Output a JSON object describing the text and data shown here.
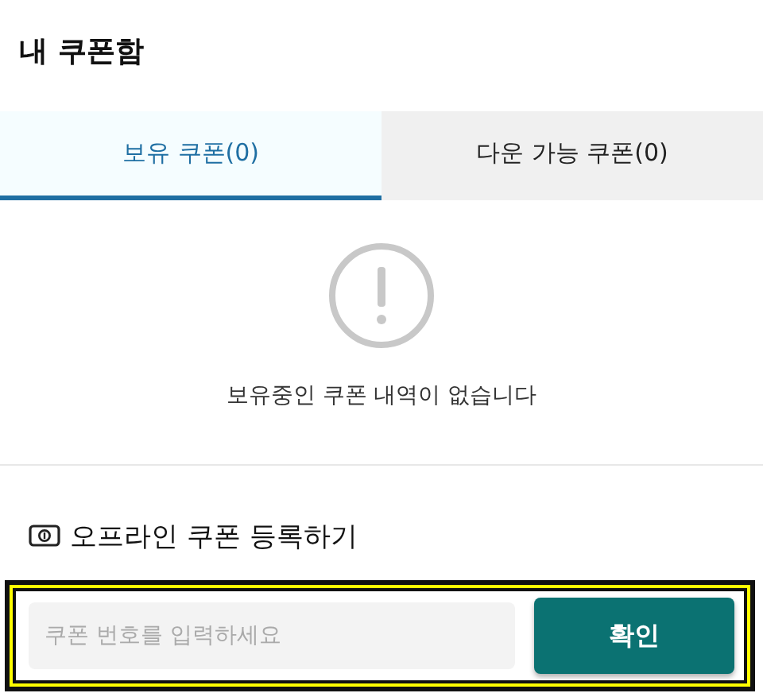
{
  "header": {
    "title": "내 쿠폰함"
  },
  "tabs": [
    {
      "label": "보유 쿠폰(0)",
      "selected": true
    },
    {
      "label": "다운 가능 쿠폰(0)",
      "selected": false
    }
  ],
  "empty_state": {
    "message": "보유중인 쿠폰 내역이 없습니다"
  },
  "offline_coupon": {
    "title": "오프라인 쿠폰 등록하기",
    "highlighted": true,
    "input": {
      "placeholder": "쿠폰 번호를 입력하세요"
    },
    "button": "확인"
  }
}
